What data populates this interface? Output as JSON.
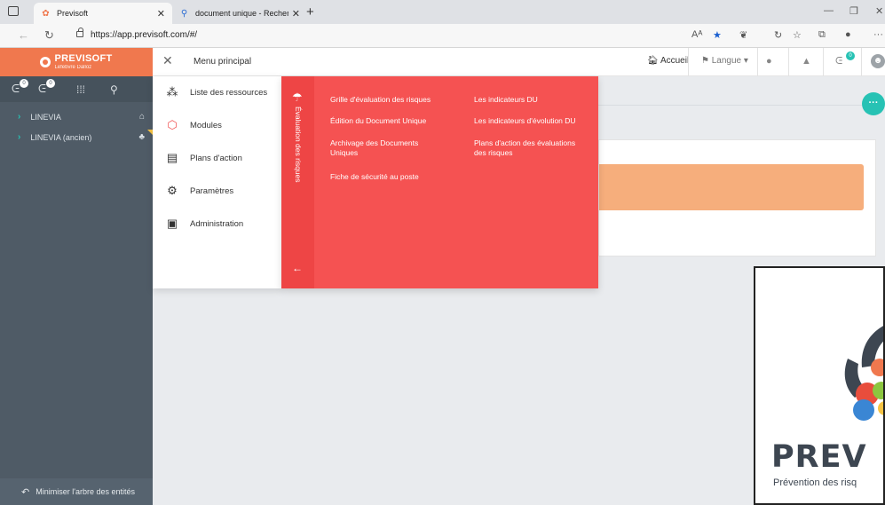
{
  "browser": {
    "tabs": [
      {
        "title": "Previsoft",
        "active": true
      },
      {
        "title": "document unique - Recherche",
        "active": false
      }
    ],
    "url": "https://app.previsoft.com/#/",
    "read_aloud_label": "Aᴬ"
  },
  "header": {
    "logo": {
      "brand": "PREVISOFT",
      "sub": "Lefebvre Dalloz"
    },
    "menu_title": "Menu principal",
    "home_label": "Accueil",
    "language_label": "Langue",
    "notification_count": "0"
  },
  "sidebar": {
    "badges": [
      "0",
      "0"
    ],
    "entities": [
      {
        "label": "LINEVIA"
      },
      {
        "label": "LINEVIA (ancien)"
      }
    ],
    "footer_label": "Minimiser l'arbre des entités"
  },
  "menu": {
    "items": [
      {
        "label": "Liste des ressources",
        "icon": "grid-icon"
      },
      {
        "label": "Modules",
        "icon": "cube-icon"
      },
      {
        "label": "Plans d'action",
        "icon": "clipboard-icon"
      },
      {
        "label": "Paramètres",
        "icon": "gear-icon"
      },
      {
        "label": "Administration",
        "icon": "briefcase-icon"
      }
    ],
    "submenu": {
      "section": "Évaluation des risques",
      "left": [
        "Grille d'évaluation des risques",
        "Édition du Document Unique",
        "Archivage des Documents Uniques",
        "Fiche de sécurité au poste"
      ],
      "right": [
        "Les indicateurs DU",
        "Les indicateurs d'évolution DU",
        "Plans d'action des évaluations des risques"
      ]
    }
  },
  "promo": {
    "word": "PREV",
    "tagline": "Prévention des risq"
  },
  "fab_label": "···",
  "colors": {
    "brand": "#f0784e",
    "accent": "#27c2b4",
    "submenu": "#f55252",
    "sidebar": "#4f5b66"
  }
}
